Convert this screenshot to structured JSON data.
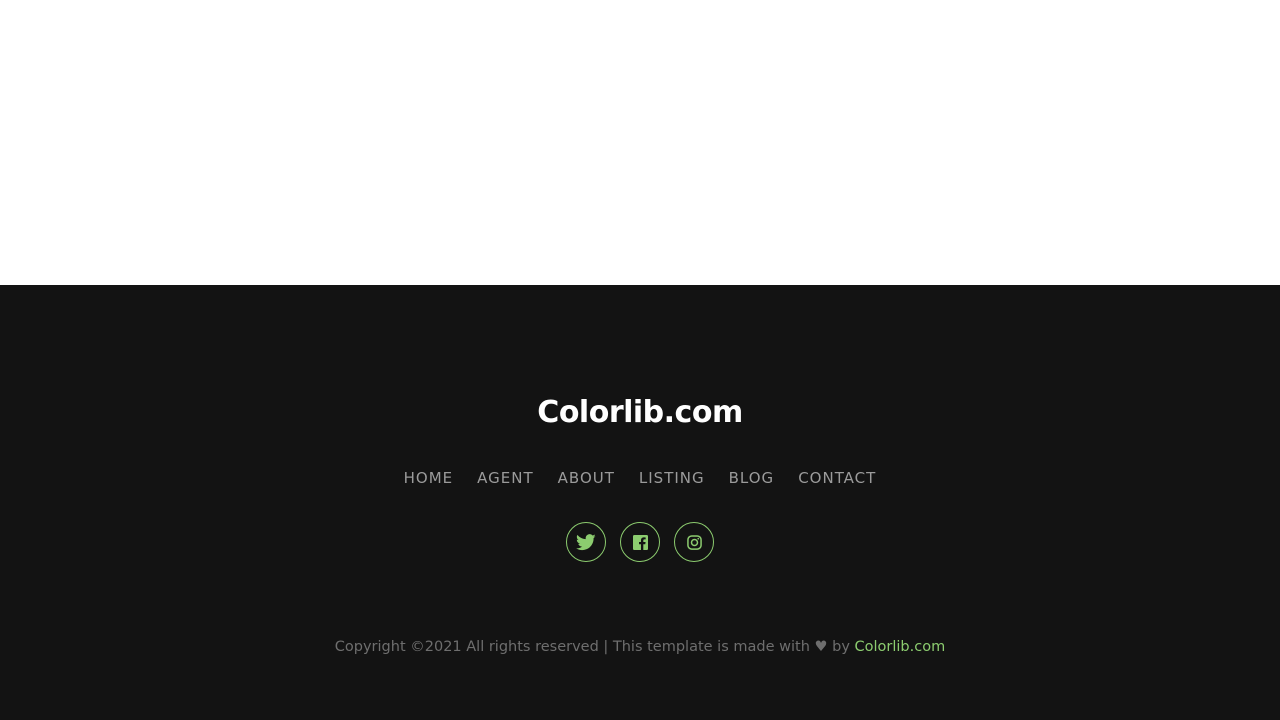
{
  "footer": {
    "brand": "Colorlib.com",
    "nav": [
      "HOME",
      "AGENT",
      "ABOUT",
      "LISTING",
      "BLOG",
      "CONTACT"
    ],
    "social": [
      {
        "icon": "twitter-icon"
      },
      {
        "icon": "facebook-icon"
      },
      {
        "icon": "instagram-icon"
      }
    ],
    "copyright": {
      "prefix": "Copyright ©2021 All rights reserved | This template is made with",
      "heart": "♥",
      "by": "by",
      "link": "Colorlib.com"
    },
    "colors": {
      "background": "#131313",
      "accent": "#8ccc6f",
      "nav_text": "#9b9b9b",
      "muted_text": "#6e6e6e"
    }
  }
}
